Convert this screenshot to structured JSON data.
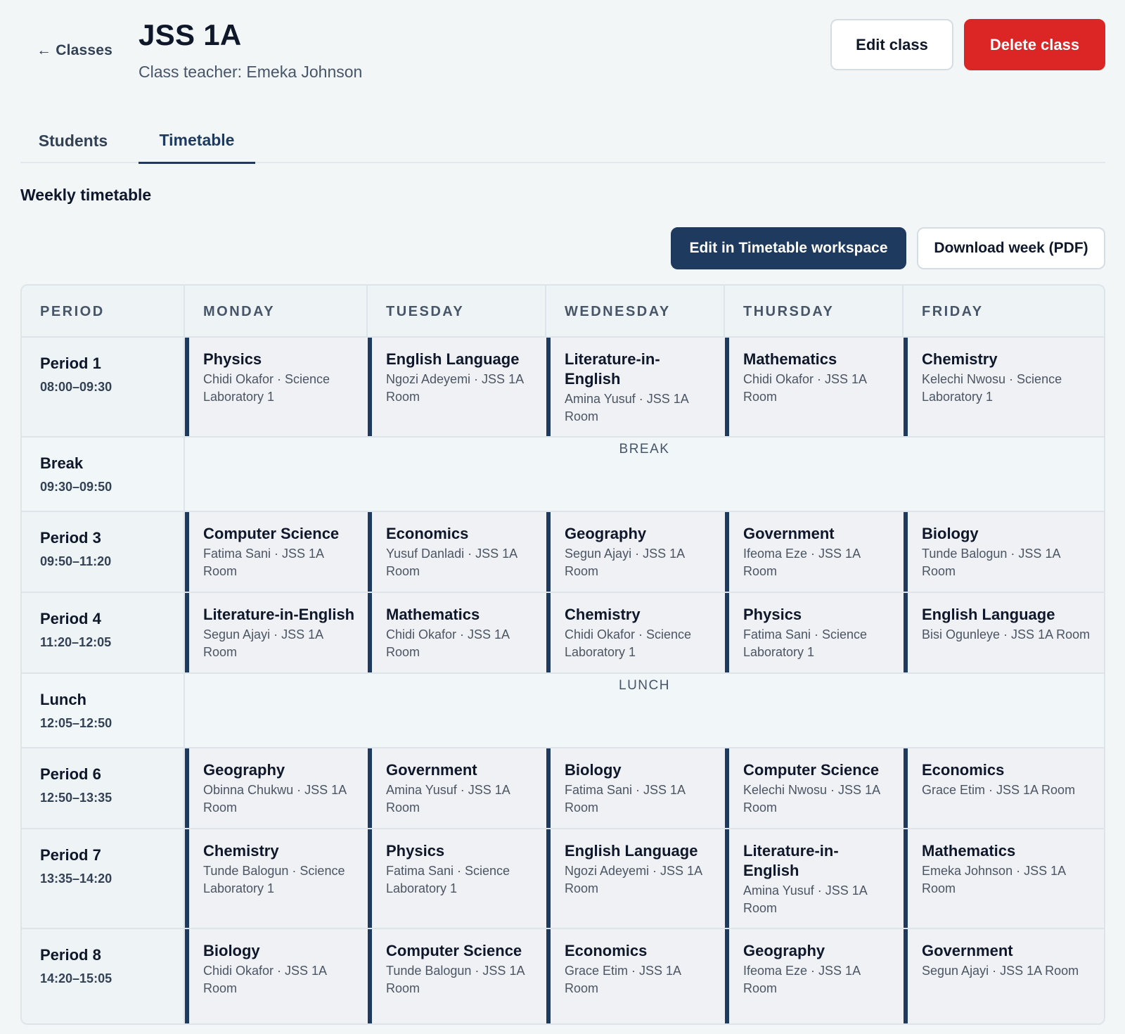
{
  "header": {
    "back_label": "← Classes",
    "title": "JSS 1A",
    "subtitle": "Class teacher: Emeka Johnson",
    "edit_label": "Edit class",
    "delete_label": "Delete class"
  },
  "tabs": [
    {
      "label": "Students",
      "active": false
    },
    {
      "label": "Timetable",
      "active": true
    }
  ],
  "section": {
    "title": "Weekly timetable",
    "workspace_button": "Edit in Timetable workspace",
    "pdf_button": "Download week (PDF)"
  },
  "colors": {
    "primary": "#1e3a5f",
    "danger": "#dc2626",
    "background": "#f2f6f7"
  },
  "timetable": {
    "headers": [
      "PERIOD",
      "MONDAY",
      "TUESDAY",
      "WEDNESDAY",
      "THURSDAY",
      "FRIDAY"
    ],
    "rows": [
      {
        "type": "lesson",
        "name": "Period 1",
        "time": "08:00–09:30",
        "cells": [
          {
            "subject": "Physics",
            "detail": "Chidi Okafor · Science Laboratory 1"
          },
          {
            "subject": "English Language",
            "detail": "Ngozi Adeyemi · JSS 1A Room"
          },
          {
            "subject": "Literature-in-English",
            "detail": "Amina Yusuf · JSS 1A Room"
          },
          {
            "subject": "Mathematics",
            "detail": "Chidi Okafor · JSS 1A Room"
          },
          {
            "subject": "Chemistry",
            "detail": "Kelechi Nwosu · Science Laboratory 1"
          }
        ]
      },
      {
        "type": "break",
        "name": "Break",
        "time": "09:30–09:50",
        "label": "BREAK"
      },
      {
        "type": "lesson",
        "name": "Period 3",
        "time": "09:50–11:20",
        "cells": [
          {
            "subject": "Computer Science",
            "detail": "Fatima Sani · JSS 1A Room"
          },
          {
            "subject": "Economics",
            "detail": "Yusuf Danladi · JSS 1A Room"
          },
          {
            "subject": "Geography",
            "detail": "Segun Ajayi · JSS 1A Room"
          },
          {
            "subject": "Government",
            "detail": "Ifeoma Eze · JSS 1A Room"
          },
          {
            "subject": "Biology",
            "detail": "Tunde Balogun · JSS 1A Room"
          }
        ]
      },
      {
        "type": "lesson",
        "name": "Period 4",
        "time": "11:20–12:05",
        "cells": [
          {
            "subject": "Literature-in-English",
            "detail": "Segun Ajayi · JSS 1A Room"
          },
          {
            "subject": "Mathematics",
            "detail": "Chidi Okafor · JSS 1A Room"
          },
          {
            "subject": "Chemistry",
            "detail": "Chidi Okafor · Science Laboratory 1"
          },
          {
            "subject": "Physics",
            "detail": "Fatima Sani · Science Laboratory 1"
          },
          {
            "subject": "English Language",
            "detail": "Bisi Ogunleye · JSS 1A Room"
          }
        ]
      },
      {
        "type": "break",
        "name": "Lunch",
        "time": "12:05–12:50",
        "label": "LUNCH"
      },
      {
        "type": "lesson",
        "name": "Period 6",
        "time": "12:50–13:35",
        "cells": [
          {
            "subject": "Geography",
            "detail": "Obinna Chukwu · JSS 1A Room"
          },
          {
            "subject": "Government",
            "detail": "Amina Yusuf · JSS 1A Room"
          },
          {
            "subject": "Biology",
            "detail": "Fatima Sani · JSS 1A Room"
          },
          {
            "subject": "Computer Science",
            "detail": "Kelechi Nwosu · JSS 1A Room"
          },
          {
            "subject": "Economics",
            "detail": "Grace Etim · JSS 1A Room"
          }
        ]
      },
      {
        "type": "lesson",
        "name": "Period 7",
        "time": "13:35–14:20",
        "cells": [
          {
            "subject": "Chemistry",
            "detail": "Tunde Balogun · Science Laboratory 1"
          },
          {
            "subject": "Physics",
            "detail": "Fatima Sani · Science Laboratory 1"
          },
          {
            "subject": "English Language",
            "detail": "Ngozi Adeyemi · JSS 1A Room"
          },
          {
            "subject": "Literature-in-English",
            "detail": "Amina Yusuf · JSS 1A Room"
          },
          {
            "subject": "Mathematics",
            "detail": "Emeka Johnson · JSS 1A Room"
          }
        ]
      },
      {
        "type": "lesson",
        "name": "Period 8",
        "time": "14:20–15:05",
        "cells": [
          {
            "subject": "Biology",
            "detail": "Chidi Okafor · JSS 1A Room"
          },
          {
            "subject": "Computer Science",
            "detail": "Tunde Balogun · JSS 1A Room"
          },
          {
            "subject": "Economics",
            "detail": "Grace Etim · JSS 1A Room"
          },
          {
            "subject": "Geography",
            "detail": "Ifeoma Eze · JSS 1A Room"
          },
          {
            "subject": "Government",
            "detail": "Segun Ajayi · JSS 1A Room"
          }
        ]
      }
    ]
  }
}
